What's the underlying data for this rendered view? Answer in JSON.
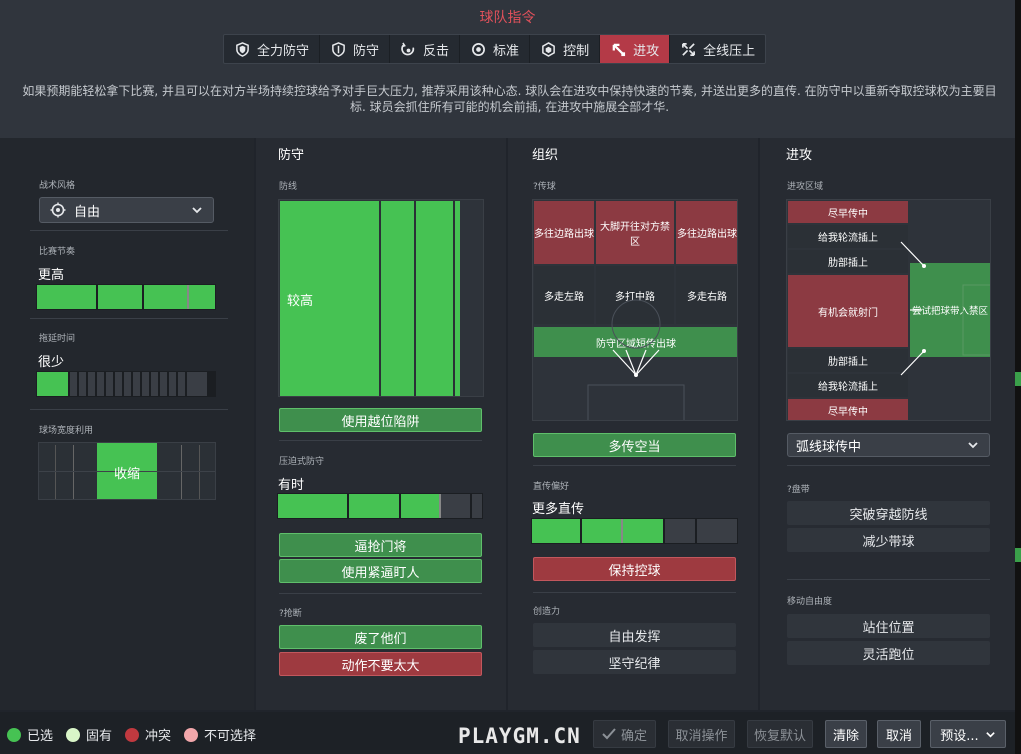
{
  "title": "球队指令",
  "tabs": [
    {
      "label": "全力防守",
      "icon": "shield-double-icon",
      "active": false
    },
    {
      "label": "防守",
      "icon": "shield-icon",
      "active": false
    },
    {
      "label": "反击",
      "icon": "counter-attack-icon",
      "active": false
    },
    {
      "label": "标准",
      "icon": "balanced-icon",
      "active": false
    },
    {
      "label": "控制",
      "icon": "control-icon",
      "active": false
    },
    {
      "label": "进攻",
      "icon": "attack-arrow-icon",
      "active": true
    },
    {
      "label": "全线压上",
      "icon": "overload-icon",
      "active": false
    }
  ],
  "description": "如果预期能轻松拿下比赛, 并且可以在对方半场持续控球给予对手巨大压力, 推荐采用该种心态. 球队会在进攻中保持快速的节奏, 并送出更多的直传. 在防守中以重新夺取控球权为主要目标. 球员会抓住所有可能的机会前插, 在进攻中施展全部才华.",
  "sidebar": {
    "style_label": "战术风格",
    "style_value": "自由",
    "tempo_label": "比赛节奏",
    "tempo_value": "更高",
    "tempo_level": 0.9,
    "timewasting_label": "拖延时间",
    "timewasting_value": "很少",
    "timewasting_level": 0.18,
    "width_label": "球场宽度利用",
    "width_value": "收缩"
  },
  "defense": {
    "title": "防守",
    "line_label": "防线",
    "line_value": "较高",
    "offside_button": "使用越位陷阱",
    "press_label": "压迫式防守",
    "press_value": "有时",
    "press_level": 0.6,
    "press_buttons": [
      "逼抢门将",
      "使用紧逼盯人"
    ],
    "tackle_label": "?抢断",
    "tackle_buttons": [
      "废了他们",
      "动作不要太大"
    ]
  },
  "buildup": {
    "title": "组织",
    "passing_label": "?传球",
    "grid_top": [
      "多往边路出球",
      "大脚开往对方禁区",
      "多往边路出球"
    ],
    "grid_mid": [
      "多走左路",
      "多打中路",
      "多走右路"
    ],
    "grid_bottom": "防守区域短传出球",
    "cross_button": "多传空当",
    "direct_label": "直传偏好",
    "direct_value": "更多直传",
    "direct_level": 0.6,
    "possession_button": "保持控球",
    "creativity_label": "创造力",
    "creativity_buttons": [
      "自由发挥",
      "坚守纪律"
    ]
  },
  "attack": {
    "title": "进攻",
    "zone_label": "进攻区域",
    "zones": [
      "尽早传中",
      "给我轮流插上",
      "肋部插上",
      "有机会就射门",
      "肋部插上",
      "给我轮流插上",
      "尽早传中"
    ],
    "box_label": "尝试把球带入禁区",
    "cross_dropdown": "弧线球传中",
    "dribble_label": "?盘带",
    "dribble_buttons": [
      "突破穿越防线",
      "减少带球"
    ],
    "movement_label": "移动自由度",
    "movement_buttons": [
      "站住位置",
      "灵活跑位"
    ]
  },
  "legend": [
    "已选",
    "固有",
    "冲突",
    "不可选择"
  ],
  "legend_colors": [
    "#46c253",
    "#d9f5c8",
    "#c0393f",
    "#f2a7ab"
  ],
  "footer_buttons": [
    "确定",
    "取消操作",
    "恢复默认",
    "清除",
    "取消",
    "预设..."
  ],
  "watermark": "PLAYGM.CN"
}
